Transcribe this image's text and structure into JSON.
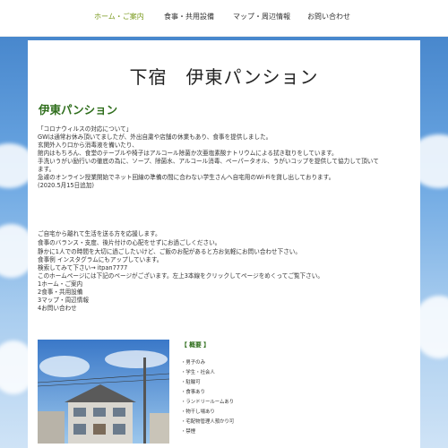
{
  "nav": {
    "items": [
      "ホーム・ご案内",
      "食事・共用設備",
      "マップ・周辺情報",
      "お問い合わせ"
    ],
    "active_color": "#7a9a1e"
  },
  "page": {
    "title": "下宿　伊東パンション",
    "heading": "伊東パンション",
    "heading_color": "#2f6e1c"
  },
  "notice": {
    "lines": [
      "「コロナウィルスの対応について」",
      "GWは通常お休み頂いてましたが、外出自粛や店舗の休業もあり、食事を提供しました。",
      "玄関外入り口から消毒液を備いたり、",
      "館内はもちろん、食堂のテーブルや椅子はアルコール除菌か次亜塩素酸ナトリウムによる拭き取りをしています。",
      "手洗いうがい励行いの徹底の為に、ソープ、除菌水、アルコール消毒、ペーパータオル、うがいコップを提供して協力して頂いて",
      "ます。",
      "急遽のオンライン授業開始でネット回線の準備の間に合わない学生さんへ自宅用のWi-Fiを貸し出しております。",
      "(2020.5月15日追加)"
    ]
  },
  "intro": {
    "lines": [
      "ご自宅から離れて生活を送る方を応援します。",
      "食事のバランス・支度、後片付けの心配をせずにお過ごしください。",
      "静かに1人での時間を大切に過ごしたいけど、ご飯のお配があると方お気軽にお問い合わせ下さい。",
      "食事例 インスタグラムにもアップしています。",
      "検索してみて下さい→ itpan7777",
      "このホームページには下記のページがございます。左上3本線をクリックしてページをめくってご覧下さい。",
      "1ホーム・ご案内",
      "2食事・共用設備",
      "3マップ・周辺情報",
      "4お問い合わせ"
    ]
  },
  "overview": {
    "title": "【 概要 】",
    "items": [
      "・男子のみ",
      "・学生・社会人",
      "・駐輪可",
      "・食事あり",
      "・ランドリールームあり",
      "・物干し場あり",
      "・宅配物管理人預かり可",
      "・禁煙"
    ]
  }
}
